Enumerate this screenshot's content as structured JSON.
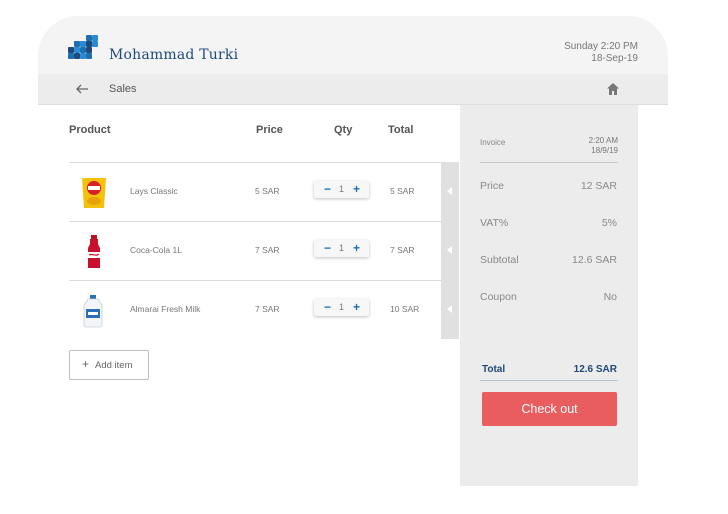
{
  "header": {
    "user_name": "Mohammad Turki",
    "date_line1": "Sunday 2:20 PM",
    "date_line2": "18-Sep-19",
    "brand_color": "#1d4a7a"
  },
  "nav": {
    "title": "Sales",
    "back_icon": "arrow-left-icon",
    "home_icon": "home-icon"
  },
  "table": {
    "headers": {
      "product": "Product",
      "price": "Price",
      "qty": "Qty",
      "total": "Total"
    },
    "rows": [
      {
        "name": "Lays Classic",
        "price": "5 SAR",
        "qty": "1",
        "total": "5 SAR",
        "icon": "chips-bag-icon"
      },
      {
        "name": "Coca-Cola 1L",
        "price": "7 SAR",
        "qty": "1",
        "total": "7 SAR",
        "icon": "cola-bottle-icon"
      },
      {
        "name": "Almarai Fresh Milk",
        "price": "7 SAR",
        "qty": "1",
        "total": "10 SAR",
        "icon": "milk-jug-icon"
      }
    ],
    "minus_label": "−",
    "plus_label": "+"
  },
  "add_item": {
    "plus": "+",
    "label": "Add item"
  },
  "invoice": {
    "label": "Invoice",
    "time": "2:20 AM",
    "date": "18/9/19",
    "lines": [
      {
        "label": "Price",
        "value": "12 SAR"
      },
      {
        "label": "VAT%",
        "value": "5%"
      },
      {
        "label": "Subtotal",
        "value": "12.6 SAR"
      },
      {
        "label": "Coupon",
        "value": "No"
      }
    ],
    "total_label": "Total",
    "total_value": "12.6 SAR",
    "checkout_label": "Check out",
    "checkout_color": "#e95d5f"
  }
}
